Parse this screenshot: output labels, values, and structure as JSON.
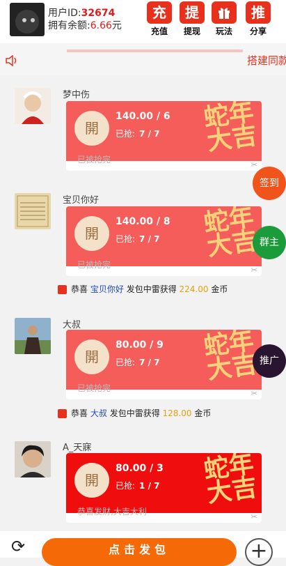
{
  "header": {
    "uid_label": "用户ID:",
    "uid_value": "32674",
    "balance_label": "拥有余额:",
    "balance_value": "6.66",
    "balance_unit": "元",
    "buttons": [
      {
        "icon_char": "充",
        "label": "充值"
      },
      {
        "icon_char": "提",
        "label": "提现"
      },
      {
        "icon_char": "",
        "icon": "gift-icon",
        "label": "玩法"
      },
      {
        "icon_char": "推",
        "label": "分享"
      }
    ]
  },
  "notice": {
    "text": "搭建同款"
  },
  "messages": [
    {
      "name": "梦中伤",
      "amount": "140.00 / 6",
      "grabbed_label": "已抢:",
      "grabbed": "7 / 7",
      "coin": "開",
      "deco": "蛇年大吉",
      "status": "已被抢完"
    },
    {
      "name": "宝贝你好",
      "amount": "140.00 / 8",
      "grabbed_label": "已抢:",
      "grabbed": "7 / 7",
      "coin": "開",
      "deco": "蛇年大吉",
      "status": "已被抢完"
    },
    {
      "name": "大叔",
      "amount": "80.00 / 9",
      "grabbed_label": "已抢:",
      "grabbed": "7 / 7",
      "coin": "開",
      "deco": "蛇年大吉",
      "status": "已被抢完"
    },
    {
      "name": "A_天寐",
      "amount": "80.00 / 3",
      "grabbed_label": "已抢:",
      "grabbed": "1 / 7",
      "coin": "開",
      "deco": "蛇年大吉",
      "status": "恭喜发财,大吉大利"
    }
  ],
  "wins": [
    {
      "prefix": "恭喜",
      "who": "宝贝你好",
      "mid": "发包中雷获得",
      "money": "224.00",
      "unit": "金币"
    },
    {
      "prefix": "恭喜",
      "who": "大叔",
      "mid": "发包中雷获得",
      "money": "128.00",
      "unit": "金币"
    }
  ],
  "floats": {
    "checkin": {
      "label": "签到",
      "color": "#f0541b"
    },
    "owner": {
      "label": "群主",
      "color": "#1c9b3a"
    },
    "promote": {
      "label": "推广",
      "color": "#2a1530"
    }
  },
  "bottom": {
    "send_label": "点击发包"
  },
  "colors": {
    "accent": "#e8311d",
    "packet": "#f45d5a",
    "packet_active": "#f00d0d",
    "send": "#f56a07"
  }
}
